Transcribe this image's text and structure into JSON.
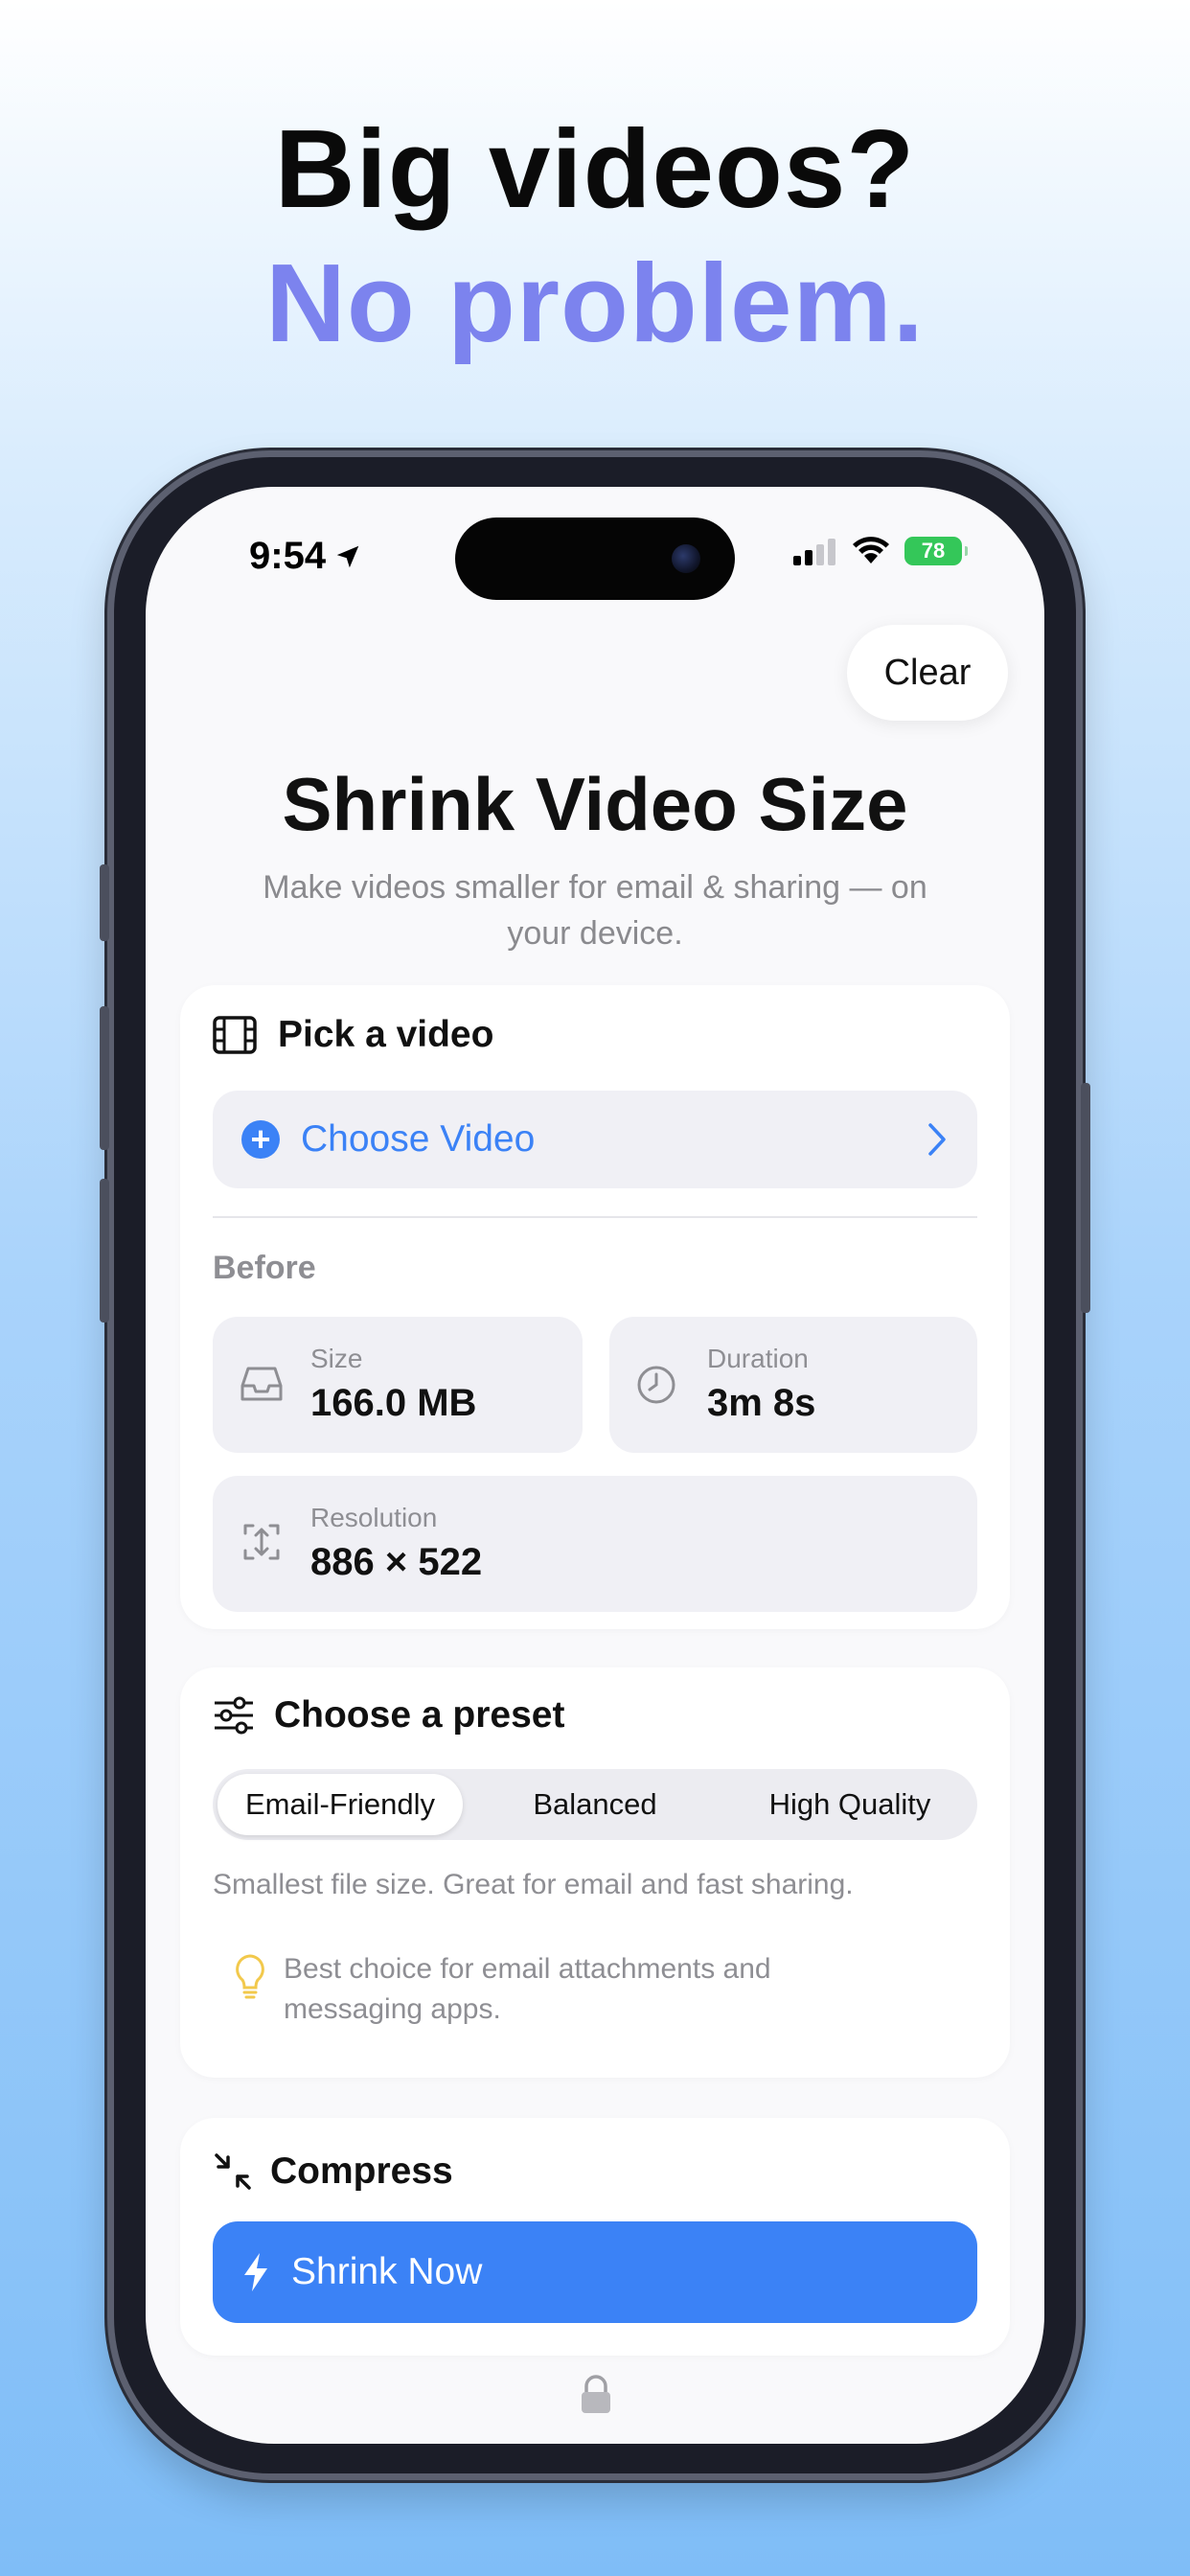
{
  "promo": {
    "line1": "Big videos?",
    "line2": "No problem."
  },
  "status_bar": {
    "time": "9:54",
    "battery": "78"
  },
  "header": {
    "clear_label": "Clear",
    "title": "Shrink Video Size",
    "subtitle": "Make videos smaller for email & sharing — on your device."
  },
  "pick_section": {
    "title": "Pick a video",
    "choose_label": "Choose Video",
    "before_label": "Before",
    "stats": {
      "size": {
        "label": "Size",
        "value": "166.0 MB"
      },
      "duration": {
        "label": "Duration",
        "value": "3m 8s"
      },
      "resolution": {
        "label": "Resolution",
        "value": "886 × 522"
      }
    }
  },
  "preset_section": {
    "title": "Choose a preset",
    "options": [
      "Email-Friendly",
      "Balanced",
      "High Quality"
    ],
    "selected": "Email-Friendly",
    "description": "Smallest file size. Great for email and fast sharing.",
    "tip": "Best choice for email attachments and messaging apps."
  },
  "compress_section": {
    "title": "Compress",
    "button_label": "Shrink Now"
  },
  "icons": {
    "film": "film-icon",
    "plus": "plus-circle-icon",
    "chevron": "chevron-right-icon",
    "tray": "tray-icon",
    "clock": "clock-icon",
    "resize": "resize-arrows-icon",
    "sliders": "sliders-icon",
    "bulb": "lightbulb-icon",
    "compress": "compress-arrows-icon",
    "bolt": "bolt-icon",
    "lock": "lock-icon"
  },
  "colors": {
    "accent": "#3b82f6",
    "headline_accent": "#7c83ee",
    "battery": "#34c759",
    "tip_bulb": "#f2c94c"
  }
}
